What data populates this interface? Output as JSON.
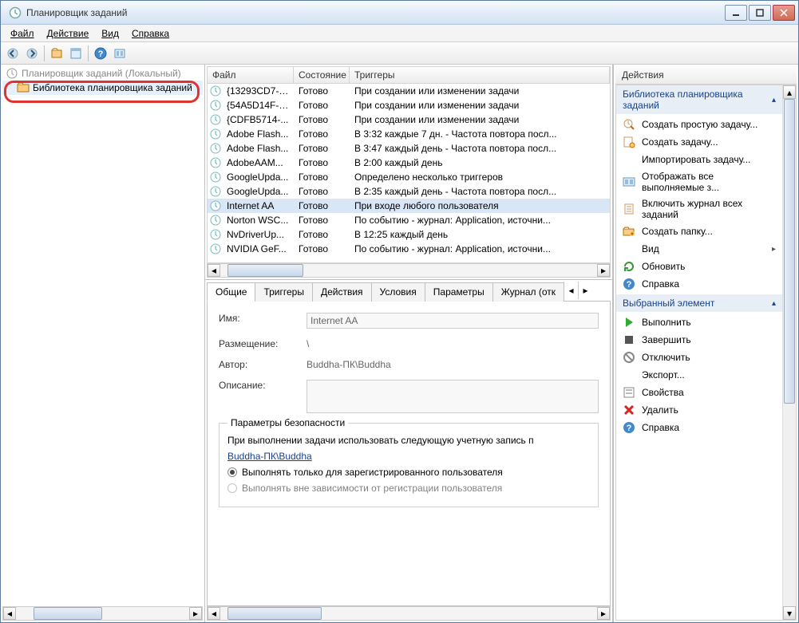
{
  "window": {
    "title": "Планировщик заданий"
  },
  "menu": {
    "file": "Файл",
    "action": "Действие",
    "view": "Вид",
    "help": "Справка"
  },
  "tree": {
    "root": "Планировщик заданий (Локальный)",
    "library": "Библиотека планировщика заданий"
  },
  "task_columns": {
    "file": "Файл",
    "state": "Состояние",
    "triggers": "Триггеры"
  },
  "tasks": [
    {
      "name": "{13293CD7-3...",
      "state": "Готово",
      "trigger": "При создании или изменении задачи"
    },
    {
      "name": "{54A5D14F-7...",
      "state": "Готово",
      "trigger": "При создании или изменении задачи"
    },
    {
      "name": "{CDFB5714-...",
      "state": "Готово",
      "trigger": "При создании или изменении задачи"
    },
    {
      "name": "Adobe Flash...",
      "state": "Готово",
      "trigger": "В 3:32 каждые 7 дн. - Частота повтора посл..."
    },
    {
      "name": "Adobe Flash...",
      "state": "Готово",
      "trigger": "В 3:47 каждый день - Частота повтора посл..."
    },
    {
      "name": "AdobeAAM...",
      "state": "Готово",
      "trigger": "В 2:00 каждый день"
    },
    {
      "name": "GoogleUpda...",
      "state": "Готово",
      "trigger": "Определено несколько триггеров"
    },
    {
      "name": "GoogleUpda...",
      "state": "Готово",
      "trigger": "В 2:35 каждый день - Частота повтора посл..."
    },
    {
      "name": "Internet AA",
      "state": "Готово",
      "trigger": "При входе любого пользователя",
      "selected": true
    },
    {
      "name": "Norton WSC...",
      "state": "Готово",
      "trigger": "По событию - журнал: Application, источни..."
    },
    {
      "name": "NvDriverUp...",
      "state": "Готово",
      "trigger": "В 12:25 каждый день"
    },
    {
      "name": "NVIDIA GeF...",
      "state": "Готово",
      "trigger": "По событию - журнал: Application, источни..."
    }
  ],
  "tabs": {
    "general": "Общие",
    "triggers": "Триггеры",
    "actions": "Действия",
    "conditions": "Условия",
    "settings": "Параметры",
    "log": "Журнал (отк"
  },
  "details": {
    "name_label": "Имя:",
    "name_value": "Internet AA",
    "location_label": "Размещение:",
    "location_value": "\\",
    "author_label": "Автор:",
    "author_value": "Buddha-ПК\\Buddha",
    "description_label": "Описание:",
    "security_group": "Параметры безопасности",
    "security_text": "При выполнении задачи использовать следующую учетную запись п",
    "security_account": "Buddha-ПК\\Buddha",
    "radio1": "Выполнять только для зарегистрированного пользователя",
    "radio2": "Выполнять вне зависимости от регистрации пользователя"
  },
  "actions_pane": {
    "header": "Действия",
    "section1_title": "Библиотека планировщика заданий",
    "section1": [
      {
        "icon": "clock-pencil",
        "label": "Создать простую задачу..."
      },
      {
        "icon": "new-task",
        "label": "Создать задачу..."
      },
      {
        "icon": "blank",
        "label": "Импортировать задачу..."
      },
      {
        "icon": "tasks-running",
        "label": "Отображать все выполняемые з..."
      },
      {
        "icon": "journal",
        "label": "Включить журнал всех заданий"
      },
      {
        "icon": "folder-new",
        "label": "Создать папку..."
      },
      {
        "icon": "blank",
        "label": "Вид",
        "submenu": true
      },
      {
        "icon": "refresh",
        "label": "Обновить"
      },
      {
        "icon": "help",
        "label": "Справка"
      }
    ],
    "section2_title": "Выбранный элемент",
    "section2": [
      {
        "icon": "play",
        "label": "Выполнить"
      },
      {
        "icon": "stop",
        "label": "Завершить"
      },
      {
        "icon": "disable",
        "label": "Отключить"
      },
      {
        "icon": "blank",
        "label": "Экспорт..."
      },
      {
        "icon": "properties",
        "label": "Свойства"
      },
      {
        "icon": "delete",
        "label": "Удалить"
      },
      {
        "icon": "help",
        "label": "Справка"
      }
    ]
  }
}
